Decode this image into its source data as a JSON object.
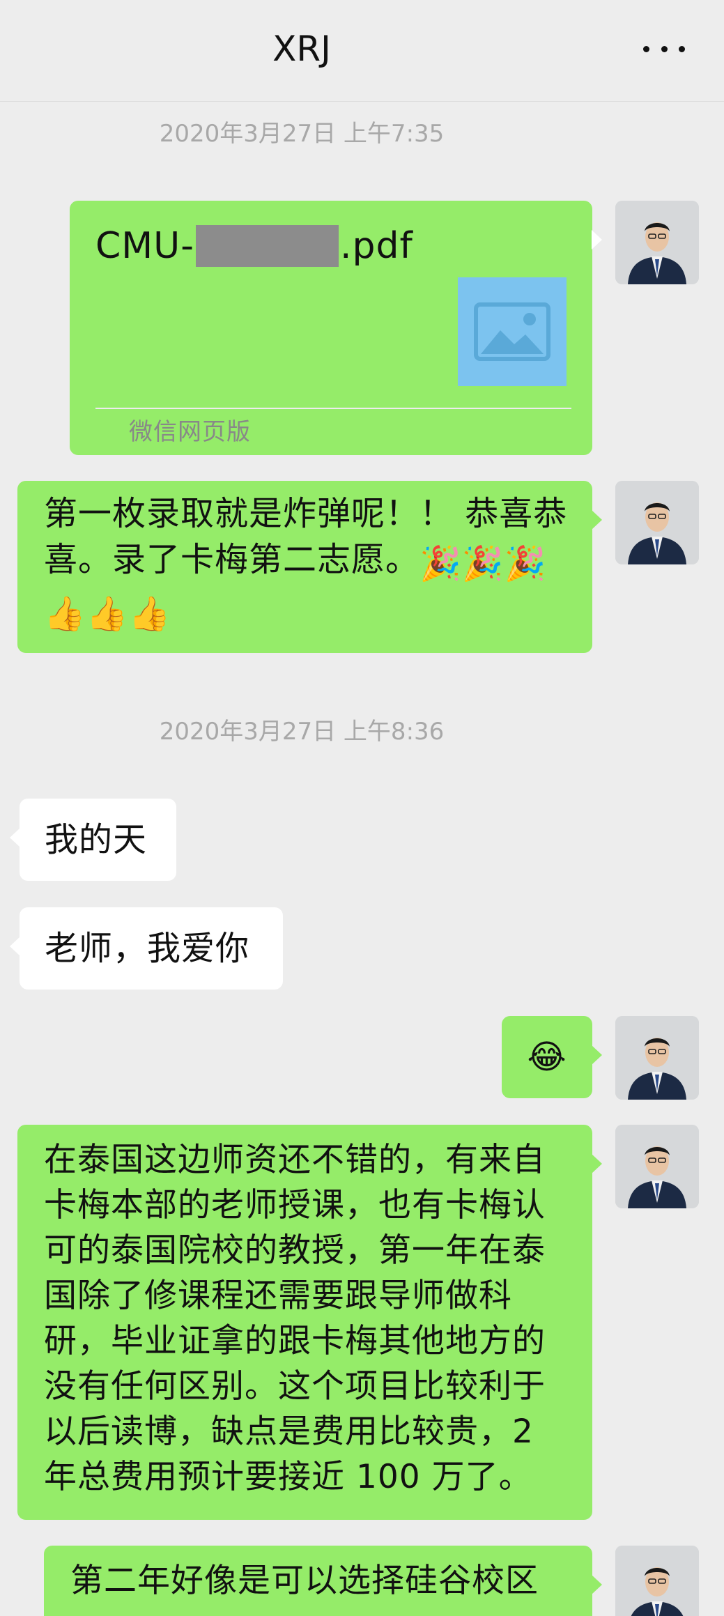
{
  "header": {
    "title": "XRJ",
    "more_icon": "more-dots-icon"
  },
  "messages": [
    {
      "type": "timestamp",
      "text": "2020年3月27日 上午7:35"
    },
    {
      "type": "file",
      "sender": "me",
      "filename_prefix": "CMU-",
      "filename_suffix": ".pdf",
      "source": "微信网页版"
    },
    {
      "type": "text",
      "sender": "me",
      "lines": [
        "第一枚录取就是炸弹呢！！ 恭喜恭",
        "喜。录了卡梅第二志愿。"
      ],
      "emojis": [
        "party-popper",
        "party-popper",
        "party-popper",
        "thumbs-up",
        "thumbs-up",
        "thumbs-up"
      ]
    },
    {
      "type": "timestamp",
      "text": "2020年3月27日 上午8:36"
    },
    {
      "type": "text",
      "sender": "other",
      "text": "我的天"
    },
    {
      "type": "text",
      "sender": "other",
      "text": "老师，我爱你"
    },
    {
      "type": "emoji",
      "sender": "me",
      "emoji": "tears-of-joy"
    },
    {
      "type": "text",
      "sender": "me",
      "lines": [
        "在泰国这边师资还不错的，有来自",
        "卡梅本部的老师授课，也有卡梅认",
        "可的泰国院校的教授，第一年在泰",
        "国除了修课程还需要跟导师做科",
        "研，毕业证拿的跟卡梅其他地方的",
        "没有任何区别。这个项目比较利于",
        "以后读博，缺点是费用比较贵，2",
        "年总费用预计要接近 100 万了。"
      ]
    },
    {
      "type": "text",
      "sender": "me",
      "lines": [
        "第二年好像是可以选择硅谷校区"
      ]
    }
  ],
  "colors": {
    "background": "#ededed",
    "my_bubble": "#95ec69",
    "other_bubble": "#ffffff",
    "timestamp": "#a8a8a8"
  }
}
